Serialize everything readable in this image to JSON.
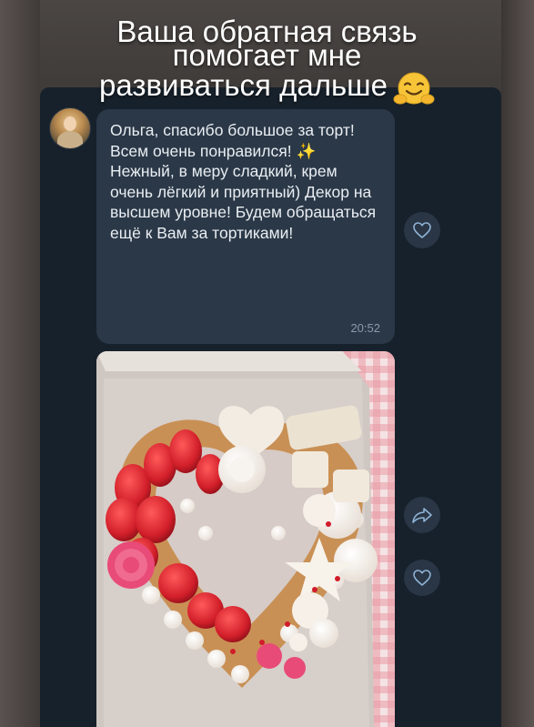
{
  "overlay": {
    "line1": "Ваша обратная связь",
    "line2": "помогает мне",
    "line3": "развиваться дальше",
    "emoji_icon": "hugging-face-icon"
  },
  "message": {
    "text_before_sparkle": "Ольга, спасибо большое за торт! Всем очень понравился! ",
    "sparkle": "✨",
    "text_after_sparkle": " Нежный, в меру сладкий, крем очень лёгкий и приятный) Декор на высшем уровне! Будем обращаться ещё к Вам за тортиками!",
    "time": "20:52"
  },
  "icons": {
    "avatar": "sender-avatar",
    "like": "heart-outline-icon",
    "share": "share-arrow-icon"
  },
  "colors": {
    "chat_background": "#17212b",
    "bubble": "#2b3847",
    "bubble_text": "#e9eef3",
    "time_text": "#8a9bab",
    "round_button": "#2a3645",
    "icon_stroke": "#8fb3d6"
  }
}
